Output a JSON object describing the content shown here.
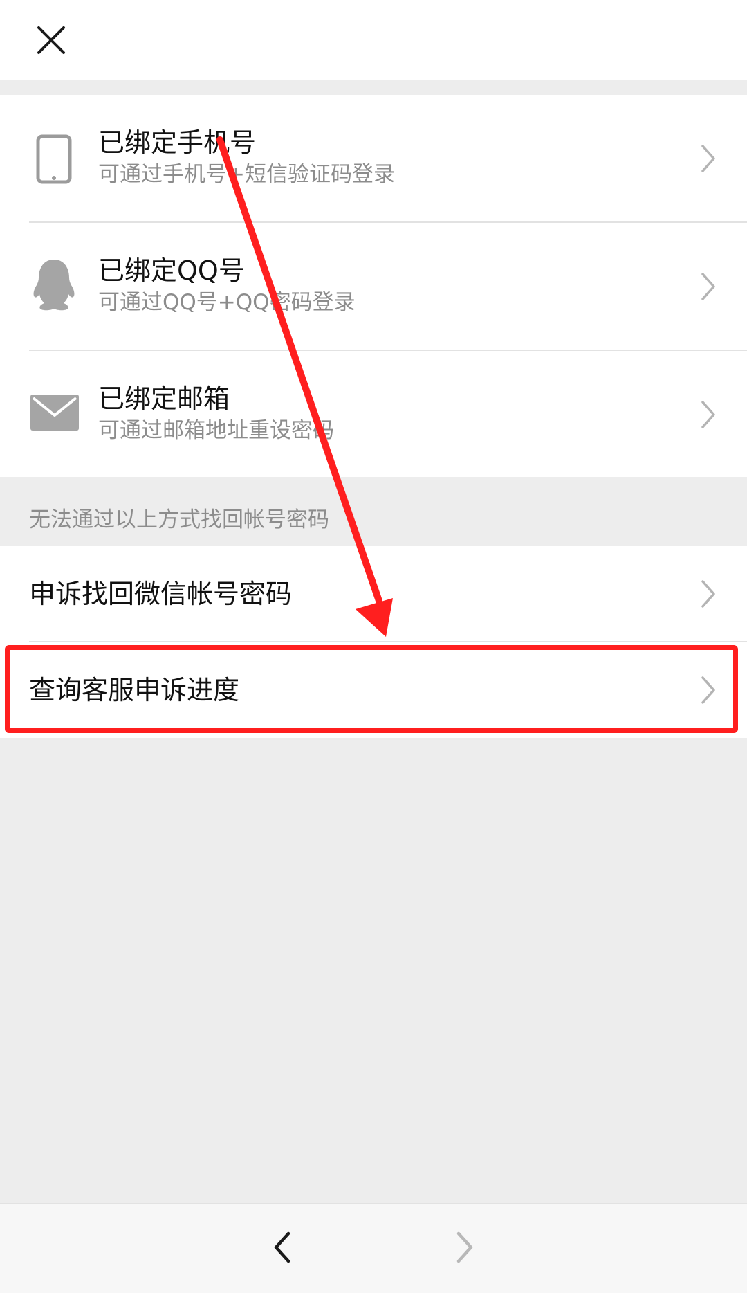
{
  "top_bar": {
    "close_icon": "close-icon"
  },
  "methods": [
    {
      "icon": "phone-icon",
      "title": "已绑定手机号",
      "subtitle": "可通过手机号+短信验证码登录"
    },
    {
      "icon": "qq-icon",
      "title": "已绑定QQ号",
      "subtitle": "可通过QQ号+QQ密码登录"
    },
    {
      "icon": "mail-icon",
      "title": "已绑定邮箱",
      "subtitle": "可通过邮箱地址重设密码"
    }
  ],
  "section_label": "无法通过以上方式找回帐号密码",
  "appeal": [
    {
      "title": "申诉找回微信帐号密码"
    },
    {
      "title": "查询客服申诉进度"
    }
  ],
  "bottom_nav": {
    "back_icon": "back-arrow-icon",
    "forward_icon": "forward-arrow-icon"
  },
  "annotation": {
    "color": "#ff1f1f",
    "arrow": "arrow-annotation",
    "highlight": "highlight-box"
  }
}
